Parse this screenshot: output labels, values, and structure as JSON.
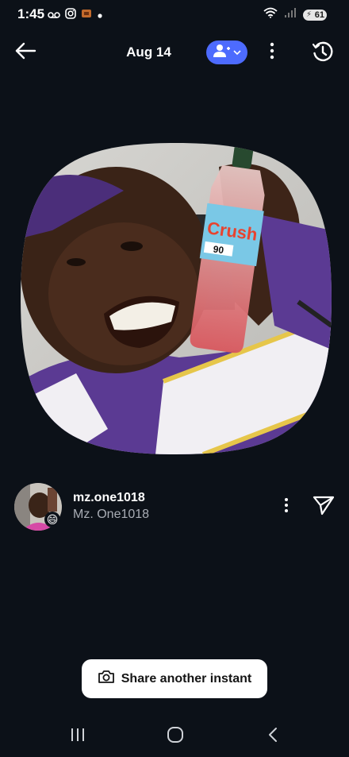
{
  "status_bar": {
    "time": "1:45",
    "battery": "61",
    "icons_left": [
      "voicemail-icon",
      "instagram-icon",
      "app-notification-icon",
      "dot-icon"
    ],
    "icons_right": [
      "wifi-icon",
      "signal-icon",
      "battery-icon"
    ]
  },
  "header": {
    "title": "Aug 14",
    "back_icon": "arrow-left-icon",
    "audience_icon": "friends-icon",
    "more_icon": "more-vertical-icon",
    "history_icon": "history-icon",
    "accent": "#4d6bfe"
  },
  "photo": {
    "description_icon": "photo-instant"
  },
  "author": {
    "username": "mz.one1018",
    "display_name": "Mz. One1018",
    "emoji": "😄"
  },
  "actions": {
    "share_label": "Share another instant",
    "share_icon": "camera-icon",
    "send_icon": "send-icon"
  },
  "nav": {
    "buttons": [
      "recents-icon",
      "home-icon",
      "back-icon"
    ]
  },
  "colors": {
    "background": "#0c1118",
    "muted_text": "#a9adb5"
  }
}
